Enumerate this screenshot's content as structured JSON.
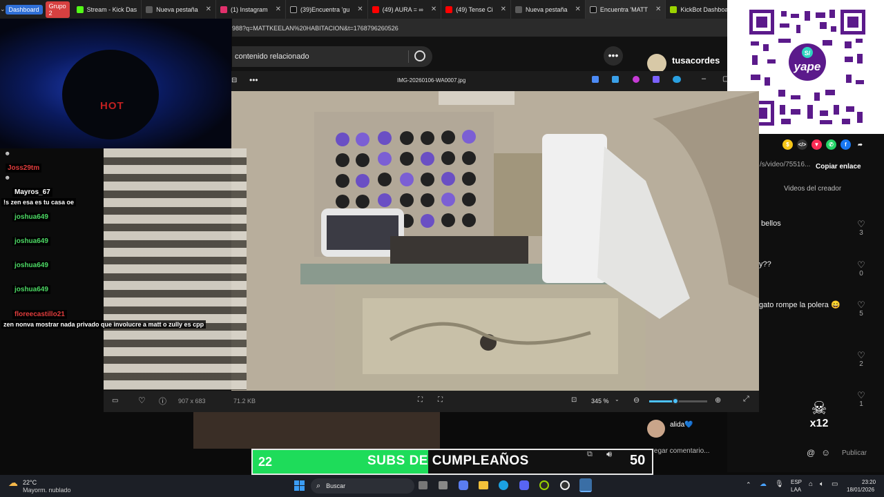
{
  "browser": {
    "tab_groups": [
      {
        "label": "Dashboard",
        "color": "#2f6fd6"
      },
      {
        "label": "Grupo 2",
        "color": "#d64040"
      }
    ],
    "tabs": [
      {
        "label": "Stream - Kick Das",
        "color": "#53fc18"
      },
      {
        "label": "Nueva pestaña",
        "color": "#5a5a5a"
      },
      {
        "label": "(1) Instagram",
        "color": "#e1306c"
      },
      {
        "label": "(39)Encuentra 'gu",
        "color": "#111111"
      },
      {
        "label": "(49) AURA = ∞",
        "color": "#ff0000"
      },
      {
        "label": "(49) Tense Ci",
        "color": "#ff0000"
      },
      {
        "label": "Nueva pestaña",
        "color": "#5a5a5a"
      },
      {
        "label": "Encuentra 'MATT",
        "color": "#111111"
      },
      {
        "label": "KickBot Dashboar",
        "color": "#9bd300"
      }
    ],
    "url": "988?q=MATTKEELAN%20HABITACION&t=1768796260526"
  },
  "webcam": {
    "shirt_text": "HOT"
  },
  "page": {
    "search_placeholder": "contenido relacionado",
    "more_icon": "•••",
    "creator_name": "tusacordes",
    "link_text": "/s/video/75516...",
    "copy_link_label": "Copiar enlace",
    "creator_videos_tab": "Videos del creador",
    "comments": [
      {
        "text": "bellos",
        "likes": "3"
      },
      {
        "text": "y??",
        "likes": "0"
      },
      {
        "text": "gato rompe la polera 😄",
        "likes": "5"
      },
      {
        "text": "",
        "likes": "2"
      },
      {
        "text": "",
        "likes": "1"
      }
    ],
    "commenter_name": "alida💙",
    "comment_placeholder": "gregar comentario...",
    "publish_label": "Publicar"
  },
  "viewer": {
    "title": "IMG-20260106-WA0007.jpg",
    "dimensions": "907 x 683",
    "file_size": "71.2 KB",
    "zoom": "345 %",
    "zoom_fraction": 0.45
  },
  "chat": {
    "messages": [
      {
        "user": "Joss29tm",
        "color": "#e03c3c",
        "text": ""
      },
      {
        "user": "Mayros_67",
        "color": "#ffffff",
        "text": "!s zen esa es tu casa oe"
      },
      {
        "user": "joshua649",
        "color": "#4cd964",
        "text": ""
      },
      {
        "user": "joshua649",
        "color": "#4cd964",
        "text": ""
      },
      {
        "user": "joshua649",
        "color": "#4cd964",
        "text": ""
      },
      {
        "user": "joshua649",
        "color": "#4cd964",
        "text": ""
      },
      {
        "user": "floreecastillo21",
        "color": "#e03c3c",
        "text": "zen nonva mostrar nada privado que involucre a matt o zully es cpp"
      }
    ]
  },
  "banner": {
    "left_value": "22",
    "title": "SUBS DE CUMPLEAÑOS",
    "right_value": "50",
    "progress_fraction": 0.44
  },
  "overlay_badge": "x12",
  "taskbar": {
    "weather_temp": "22°C",
    "weather_desc": "Mayorm. nublado",
    "search_label": "Buscar",
    "lang_line1": "ESP",
    "lang_line2": "LAA",
    "time": "23:20",
    "date": "18/01/2026"
  }
}
